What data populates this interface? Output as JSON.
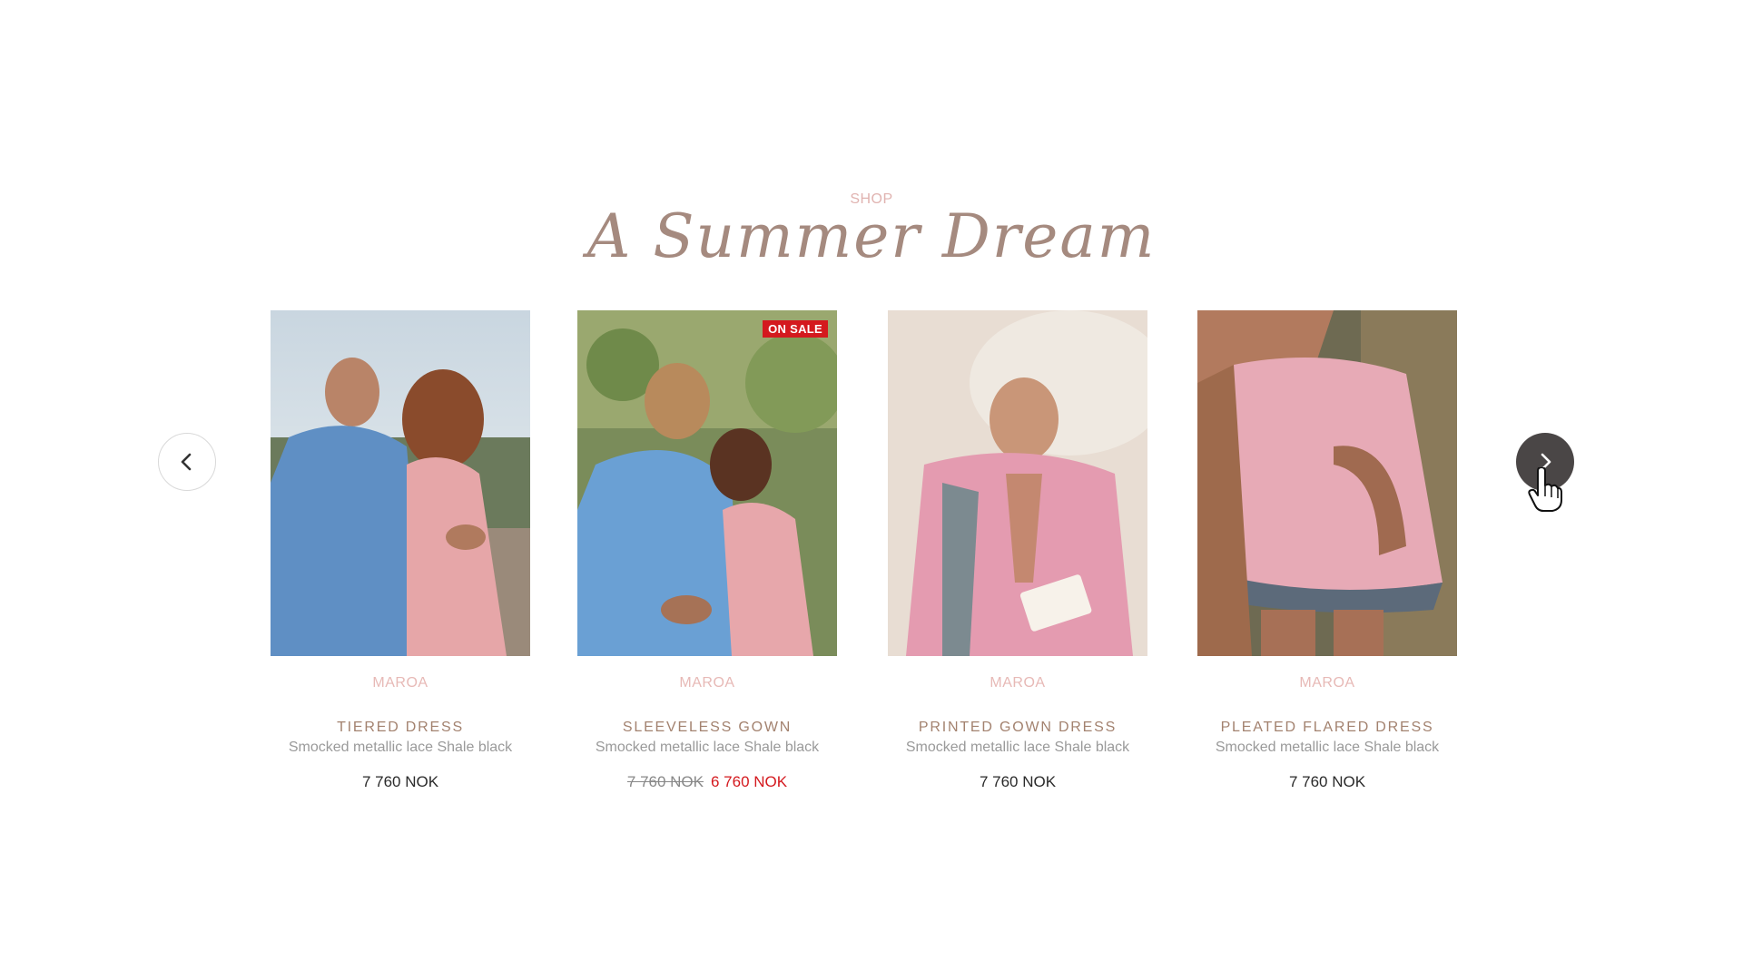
{
  "header": {
    "eyebrow": "SHOP",
    "title": "A Summer Dream"
  },
  "carousel": {
    "prev_icon": "chevron-left-icon",
    "next_icon": "chevron-right-icon",
    "products": [
      {
        "brand": "MAROA",
        "name": "TIERED DRESS",
        "desc": "Smocked metallic lace Shale black",
        "price": "7 760 NOK"
      },
      {
        "brand": "MAROA",
        "name": "SLEEVELESS GOWN",
        "desc": "Smocked metallic lace Shale black",
        "price_old": "7 760 NOK",
        "price_new": "6 760 NOK",
        "badge": "ON SALE"
      },
      {
        "brand": "MAROA",
        "name": "PRINTED GOWN DRESS",
        "desc": "Smocked metallic lace Shale black",
        "price": "7 760 NOK"
      },
      {
        "brand": "MAROA",
        "name": "PLEATED FLARED DRESS",
        "desc": "Smocked metallic lace Shale black",
        "price": "7 760 NOK"
      }
    ]
  },
  "colors": {
    "accent_pink": "#e0b3b0",
    "title_brown": "#a58a7f",
    "sale_red": "#d4191e"
  }
}
